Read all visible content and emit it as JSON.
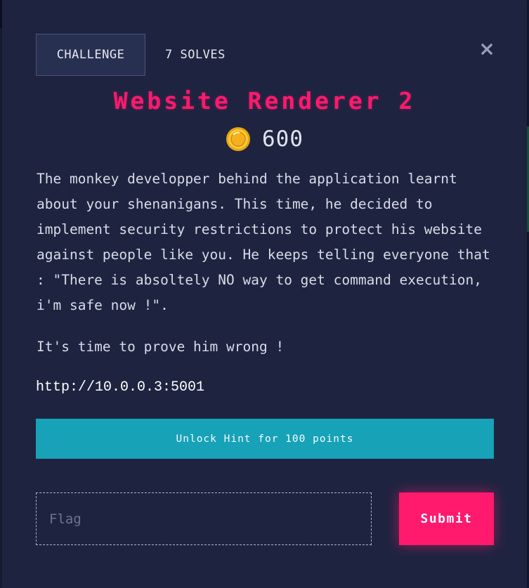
{
  "tabs": {
    "challenge_label": "CHALLENGE",
    "solves_label": "7 SOLVES"
  },
  "challenge": {
    "title": "Website Renderer 2",
    "points": "600",
    "description": [
      "The monkey developper behind the application learnt about your shenanigans. This time, he decided to implement security restrictions to protect his website against people like you. He keeps telling everyone that : \"There is absoltely NO way to get command execution, i'm safe now !\".",
      "It's time to prove him wrong !"
    ],
    "url": "http://10.0.0.3:5001"
  },
  "hint": {
    "label": "Unlock Hint for 100 points"
  },
  "submission": {
    "flag_placeholder": "Flag",
    "flag_value": "",
    "submit_label": "Submit"
  },
  "icons": {
    "close": "close-icon",
    "coin": "coin-icon"
  },
  "colors": {
    "accent": "#ff1a6e",
    "hint": "#17a2b8",
    "background": "#1e2440"
  }
}
